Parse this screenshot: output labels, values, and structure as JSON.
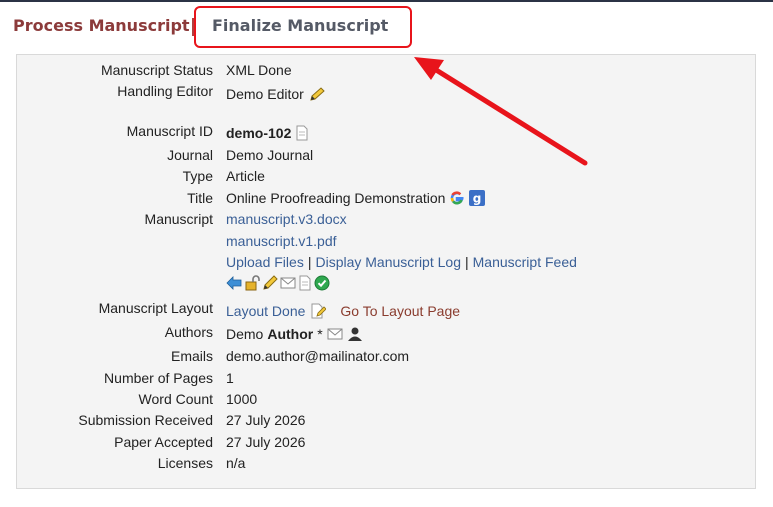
{
  "tabs": {
    "process": "Process Manuscript",
    "finalize": "Finalize Manuscript"
  },
  "fields": {
    "status": {
      "label": "Manuscript Status",
      "value": "XML Done"
    },
    "editor": {
      "label": "Handling Editor",
      "value": "Demo Editor"
    },
    "id": {
      "label": "Manuscript ID",
      "value": "demo-102"
    },
    "journal": {
      "label": "Journal",
      "value": "Demo Journal"
    },
    "type": {
      "label": "Type",
      "value": "Article"
    },
    "title": {
      "label": "Title",
      "value": "Online Proofreading Demonstration"
    },
    "manuscript": {
      "label": "Manuscript",
      "file1": "manuscript.v3.docx",
      "file2": "manuscript.v1.pdf",
      "upload": "Upload Files",
      "sep": "|",
      "log": "Display Manuscript Log",
      "feed": "Manuscript Feed"
    },
    "layout": {
      "label": "Manuscript Layout",
      "done": "Layout Done",
      "goto": "Go To Layout Page"
    },
    "authors": {
      "label": "Authors",
      "first": "Demo",
      "last": "Author",
      "mark": "*"
    },
    "emails": {
      "label": "Emails",
      "value": "demo.author@mailinator.com"
    },
    "pages": {
      "label": "Number of Pages",
      "value": "1"
    },
    "words": {
      "label": "Word Count",
      "value": "1000"
    },
    "received": {
      "label": "Submission Received",
      "value": "27 July 2026"
    },
    "accepted": {
      "label": "Paper Accepted",
      "value": "27 July 2026"
    },
    "licenses": {
      "label": "Licenses",
      "value": "n/a"
    }
  },
  "colors": {
    "accent_red": "#e8141b",
    "link": "#3a5f96",
    "tab_active": "#8c3b3b"
  }
}
